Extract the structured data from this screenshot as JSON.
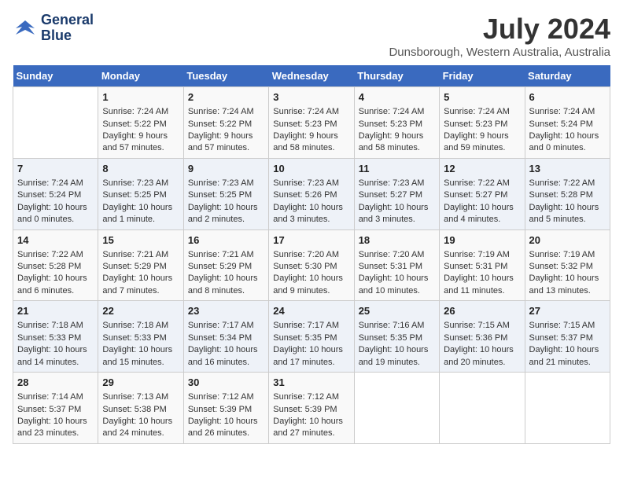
{
  "logo": {
    "line1": "General",
    "line2": "Blue"
  },
  "title": "July 2024",
  "subtitle": "Dunsborough, Western Australia, Australia",
  "days_of_week": [
    "Sunday",
    "Monday",
    "Tuesday",
    "Wednesday",
    "Thursday",
    "Friday",
    "Saturday"
  ],
  "weeks": [
    [
      {
        "day": "",
        "sunrise": "",
        "sunset": "",
        "daylight": ""
      },
      {
        "day": "1",
        "sunrise": "Sunrise: 7:24 AM",
        "sunset": "Sunset: 5:22 PM",
        "daylight": "Daylight: 9 hours and 57 minutes."
      },
      {
        "day": "2",
        "sunrise": "Sunrise: 7:24 AM",
        "sunset": "Sunset: 5:22 PM",
        "daylight": "Daylight: 9 hours and 57 minutes."
      },
      {
        "day": "3",
        "sunrise": "Sunrise: 7:24 AM",
        "sunset": "Sunset: 5:23 PM",
        "daylight": "Daylight: 9 hours and 58 minutes."
      },
      {
        "day": "4",
        "sunrise": "Sunrise: 7:24 AM",
        "sunset": "Sunset: 5:23 PM",
        "daylight": "Daylight: 9 hours and 58 minutes."
      },
      {
        "day": "5",
        "sunrise": "Sunrise: 7:24 AM",
        "sunset": "Sunset: 5:23 PM",
        "daylight": "Daylight: 9 hours and 59 minutes."
      },
      {
        "day": "6",
        "sunrise": "Sunrise: 7:24 AM",
        "sunset": "Sunset: 5:24 PM",
        "daylight": "Daylight: 10 hours and 0 minutes."
      }
    ],
    [
      {
        "day": "7",
        "sunrise": "Sunrise: 7:24 AM",
        "sunset": "Sunset: 5:24 PM",
        "daylight": "Daylight: 10 hours and 0 minutes."
      },
      {
        "day": "8",
        "sunrise": "Sunrise: 7:23 AM",
        "sunset": "Sunset: 5:25 PM",
        "daylight": "Daylight: 10 hours and 1 minute."
      },
      {
        "day": "9",
        "sunrise": "Sunrise: 7:23 AM",
        "sunset": "Sunset: 5:25 PM",
        "daylight": "Daylight: 10 hours and 2 minutes."
      },
      {
        "day": "10",
        "sunrise": "Sunrise: 7:23 AM",
        "sunset": "Sunset: 5:26 PM",
        "daylight": "Daylight: 10 hours and 3 minutes."
      },
      {
        "day": "11",
        "sunrise": "Sunrise: 7:23 AM",
        "sunset": "Sunset: 5:27 PM",
        "daylight": "Daylight: 10 hours and 3 minutes."
      },
      {
        "day": "12",
        "sunrise": "Sunrise: 7:22 AM",
        "sunset": "Sunset: 5:27 PM",
        "daylight": "Daylight: 10 hours and 4 minutes."
      },
      {
        "day": "13",
        "sunrise": "Sunrise: 7:22 AM",
        "sunset": "Sunset: 5:28 PM",
        "daylight": "Daylight: 10 hours and 5 minutes."
      }
    ],
    [
      {
        "day": "14",
        "sunrise": "Sunrise: 7:22 AM",
        "sunset": "Sunset: 5:28 PM",
        "daylight": "Daylight: 10 hours and 6 minutes."
      },
      {
        "day": "15",
        "sunrise": "Sunrise: 7:21 AM",
        "sunset": "Sunset: 5:29 PM",
        "daylight": "Daylight: 10 hours and 7 minutes."
      },
      {
        "day": "16",
        "sunrise": "Sunrise: 7:21 AM",
        "sunset": "Sunset: 5:29 PM",
        "daylight": "Daylight: 10 hours and 8 minutes."
      },
      {
        "day": "17",
        "sunrise": "Sunrise: 7:20 AM",
        "sunset": "Sunset: 5:30 PM",
        "daylight": "Daylight: 10 hours and 9 minutes."
      },
      {
        "day": "18",
        "sunrise": "Sunrise: 7:20 AM",
        "sunset": "Sunset: 5:31 PM",
        "daylight": "Daylight: 10 hours and 10 minutes."
      },
      {
        "day": "19",
        "sunrise": "Sunrise: 7:19 AM",
        "sunset": "Sunset: 5:31 PM",
        "daylight": "Daylight: 10 hours and 11 minutes."
      },
      {
        "day": "20",
        "sunrise": "Sunrise: 7:19 AM",
        "sunset": "Sunset: 5:32 PM",
        "daylight": "Daylight: 10 hours and 13 minutes."
      }
    ],
    [
      {
        "day": "21",
        "sunrise": "Sunrise: 7:18 AM",
        "sunset": "Sunset: 5:33 PM",
        "daylight": "Daylight: 10 hours and 14 minutes."
      },
      {
        "day": "22",
        "sunrise": "Sunrise: 7:18 AM",
        "sunset": "Sunset: 5:33 PM",
        "daylight": "Daylight: 10 hours and 15 minutes."
      },
      {
        "day": "23",
        "sunrise": "Sunrise: 7:17 AM",
        "sunset": "Sunset: 5:34 PM",
        "daylight": "Daylight: 10 hours and 16 minutes."
      },
      {
        "day": "24",
        "sunrise": "Sunrise: 7:17 AM",
        "sunset": "Sunset: 5:35 PM",
        "daylight": "Daylight: 10 hours and 17 minutes."
      },
      {
        "day": "25",
        "sunrise": "Sunrise: 7:16 AM",
        "sunset": "Sunset: 5:35 PM",
        "daylight": "Daylight: 10 hours and 19 minutes."
      },
      {
        "day": "26",
        "sunrise": "Sunrise: 7:15 AM",
        "sunset": "Sunset: 5:36 PM",
        "daylight": "Daylight: 10 hours and 20 minutes."
      },
      {
        "day": "27",
        "sunrise": "Sunrise: 7:15 AM",
        "sunset": "Sunset: 5:37 PM",
        "daylight": "Daylight: 10 hours and 21 minutes."
      }
    ],
    [
      {
        "day": "28",
        "sunrise": "Sunrise: 7:14 AM",
        "sunset": "Sunset: 5:37 PM",
        "daylight": "Daylight: 10 hours and 23 minutes."
      },
      {
        "day": "29",
        "sunrise": "Sunrise: 7:13 AM",
        "sunset": "Sunset: 5:38 PM",
        "daylight": "Daylight: 10 hours and 24 minutes."
      },
      {
        "day": "30",
        "sunrise": "Sunrise: 7:12 AM",
        "sunset": "Sunset: 5:39 PM",
        "daylight": "Daylight: 10 hours and 26 minutes."
      },
      {
        "day": "31",
        "sunrise": "Sunrise: 7:12 AM",
        "sunset": "Sunset: 5:39 PM",
        "daylight": "Daylight: 10 hours and 27 minutes."
      },
      {
        "day": "",
        "sunrise": "",
        "sunset": "",
        "daylight": ""
      },
      {
        "day": "",
        "sunrise": "",
        "sunset": "",
        "daylight": ""
      },
      {
        "day": "",
        "sunrise": "",
        "sunset": "",
        "daylight": ""
      }
    ]
  ]
}
